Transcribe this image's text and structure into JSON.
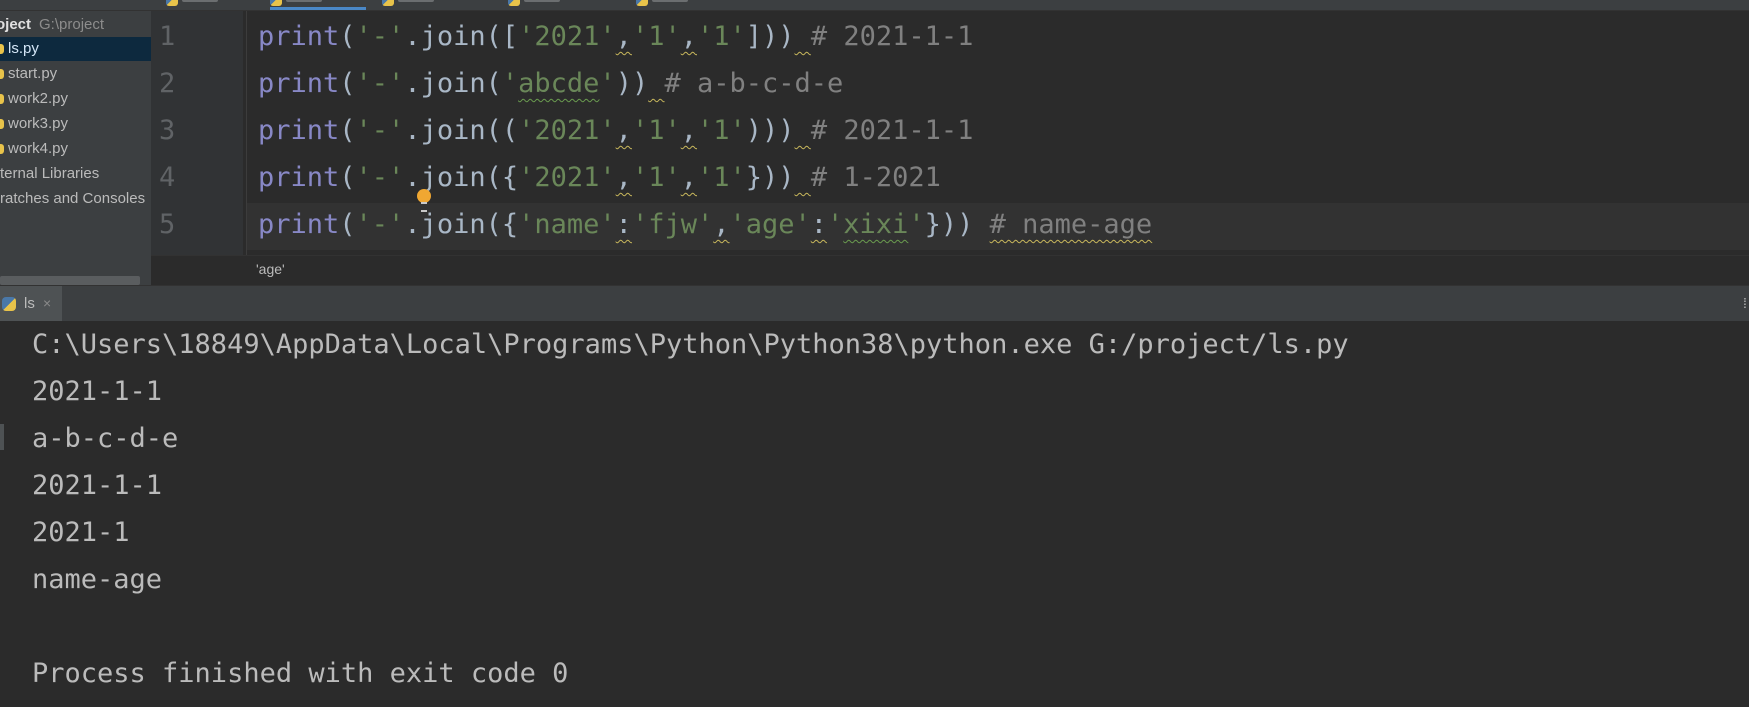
{
  "project": {
    "title": "oject",
    "path": "G:\\project",
    "files": [
      {
        "label": "ls.py",
        "selected": true
      },
      {
        "label": "start.py",
        "selected": false
      },
      {
        "label": "work2.py",
        "selected": false
      },
      {
        "label": "work3.py",
        "selected": false
      },
      {
        "label": "work4.py",
        "selected": false
      }
    ],
    "external": "ternal Libraries",
    "scratches": "ratches and Consoles"
  },
  "editor": {
    "line_numbers": [
      "1",
      "2",
      "3",
      "4",
      "5"
    ],
    "comments": [
      "# 2021-1-1",
      "# a-b-c-d-e",
      "# 2021-1-1",
      "# 1-2021",
      "# name-age"
    ],
    "current_line": 5,
    "breadcrumb": "'age'"
  },
  "run": {
    "tab_label": "ls",
    "tab_close": "×",
    "output": [
      "C:\\Users\\18849\\AppData\\Local\\Programs\\Python\\Python38\\python.exe G:/project/ls.py",
      "2021-1-1",
      "a-b-c-d-e",
      "2021-1-1",
      "2021-1",
      "name-age",
      "",
      "Process finished with exit code 0"
    ]
  },
  "colors": {
    "background": "#2b2b2b",
    "keyword": "#8888c6",
    "string": "#6a8759",
    "comment": "#808080",
    "selection": "#0d293e"
  }
}
